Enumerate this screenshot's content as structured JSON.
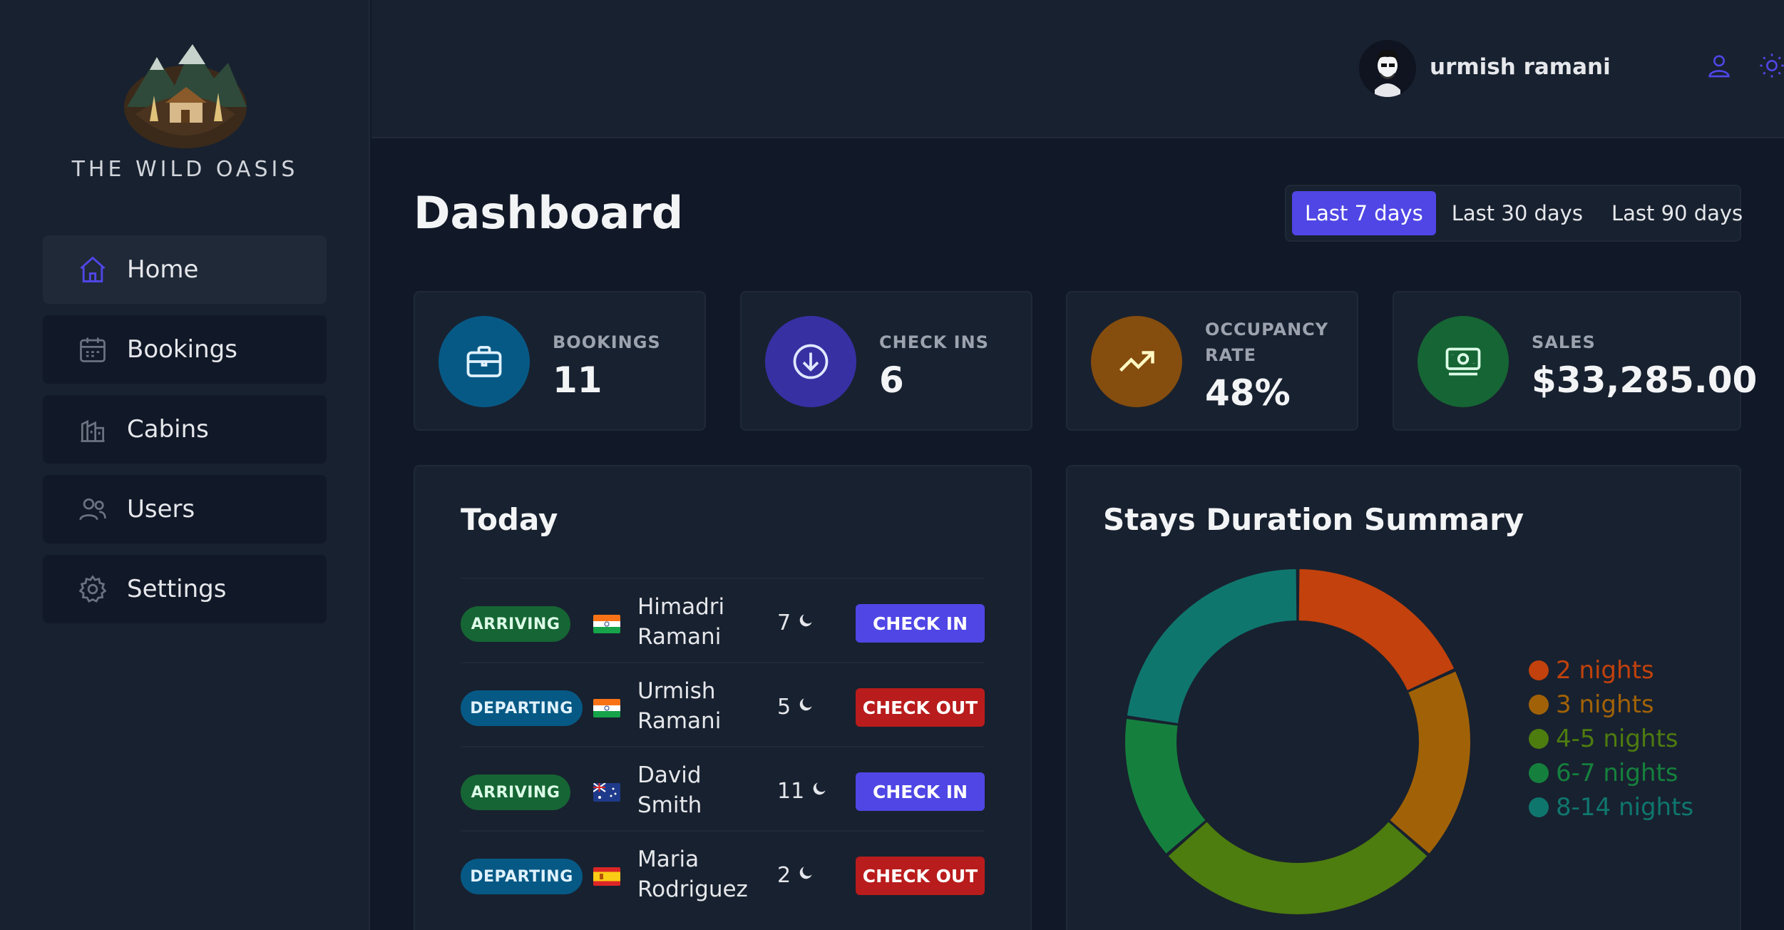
{
  "brand": {
    "name": "THE WILD OASIS"
  },
  "sidebar": {
    "items": [
      {
        "label": "Home",
        "icon": "home-icon",
        "active": true
      },
      {
        "label": "Bookings",
        "icon": "calendar-icon",
        "active": false
      },
      {
        "label": "Cabins",
        "icon": "cabins-icon",
        "active": false
      },
      {
        "label": "Users",
        "icon": "users-icon",
        "active": false
      },
      {
        "label": "Settings",
        "icon": "gear-icon",
        "active": false
      }
    ]
  },
  "header": {
    "username": "urmish ramani",
    "icons": [
      "user-icon",
      "sun-icon",
      "logout-icon"
    ]
  },
  "main": {
    "title": "Dashboard",
    "filters": [
      {
        "label": "Last 7 days",
        "active": true
      },
      {
        "label": "Last 30 days",
        "active": false
      },
      {
        "label": "Last 90 days",
        "active": false
      }
    ],
    "stats": [
      {
        "label": "BOOKINGS",
        "value": "11",
        "icon": "briefcase-icon",
        "color": "#075985"
      },
      {
        "label": "CHECK INS",
        "value": "6",
        "icon": "arrow-down-circle-icon",
        "color": "#3730a3"
      },
      {
        "label_line1": "OCCUPANCY",
        "label_line2": "RATE",
        "value": "48%",
        "icon": "trending-up-icon",
        "color": "#854d0e"
      },
      {
        "label": "SALES",
        "value": "$33,285.00",
        "icon": "banknote-icon",
        "color": "#166534"
      }
    ]
  },
  "today": {
    "title": "Today",
    "rows": [
      {
        "status": "ARRIVING",
        "flag": "india",
        "name_line1": "Himadri",
        "name_line2": "Ramani",
        "nights": "7",
        "action": "CHECK IN"
      },
      {
        "status": "DEPARTING",
        "flag": "india",
        "name_line1": "Urmish",
        "name_line2": "Ramani",
        "nights": "5",
        "action": "CHECK OUT"
      },
      {
        "status": "ARRIVING",
        "flag": "australia",
        "name_line1": "David",
        "name_line2": "Smith",
        "nights": "11",
        "action": "CHECK IN"
      },
      {
        "status": "DEPARTING",
        "flag": "spain",
        "name_line1": "Maria",
        "name_line2": "Rodriguez",
        "nights": "2",
        "action": "CHECK OUT"
      }
    ]
  },
  "chart_data": {
    "type": "pie",
    "variant": "donut",
    "title": "Stays Duration Summary",
    "categories": [
      "2 nights",
      "3 nights",
      "4-5 nights",
      "6-7 nights",
      "8-14 nights"
    ],
    "values": [
      2,
      2,
      3,
      1.5,
      2.5
    ],
    "colors": [
      "#c2410c",
      "#a16207",
      "#4d7c0f",
      "#15803d",
      "#0f766e"
    ],
    "legend_position": "right"
  }
}
